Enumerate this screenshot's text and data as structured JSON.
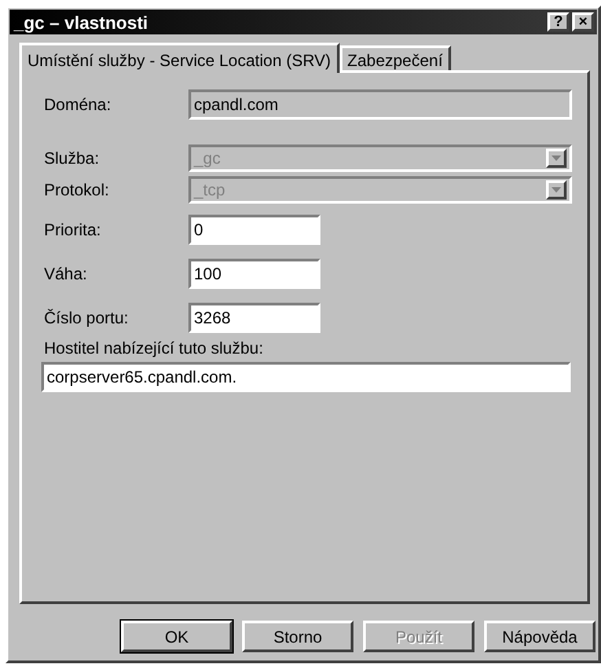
{
  "window": {
    "title": "_gc – vlastnosti",
    "help": "?",
    "close": "×"
  },
  "tabs": [
    {
      "label": "Umístění služby - Service Location (SRV)",
      "selected": true
    },
    {
      "label": "Zabezpečení",
      "selected": false
    }
  ],
  "fields": [
    {
      "kind": "readonly",
      "label": "Doména:",
      "value": "cpandl.com"
    },
    {
      "kind": "combo",
      "label": "Služba:",
      "value": "_gc",
      "disabled": true
    },
    {
      "kind": "combo",
      "label": "Protokol:",
      "value": "_tcp",
      "disabled": true
    },
    {
      "kind": "short",
      "label": "Priorita:",
      "value": "0"
    },
    {
      "kind": "short",
      "label": "Váha:",
      "value": "100"
    },
    {
      "kind": "short",
      "label": "Číslo portu:",
      "value": "3268"
    },
    {
      "kind": "wide",
      "label": "Hostitel nabízející tuto službu:",
      "value": "corpserver65.cpandl.com."
    }
  ],
  "buttons": [
    {
      "label": "OK",
      "default": true,
      "disabled": false
    },
    {
      "label": "Storno",
      "default": false,
      "disabled": false
    },
    {
      "label": "Použít",
      "default": false,
      "disabled": true
    },
    {
      "label": "Nápověda",
      "default": false,
      "disabled": false
    }
  ]
}
